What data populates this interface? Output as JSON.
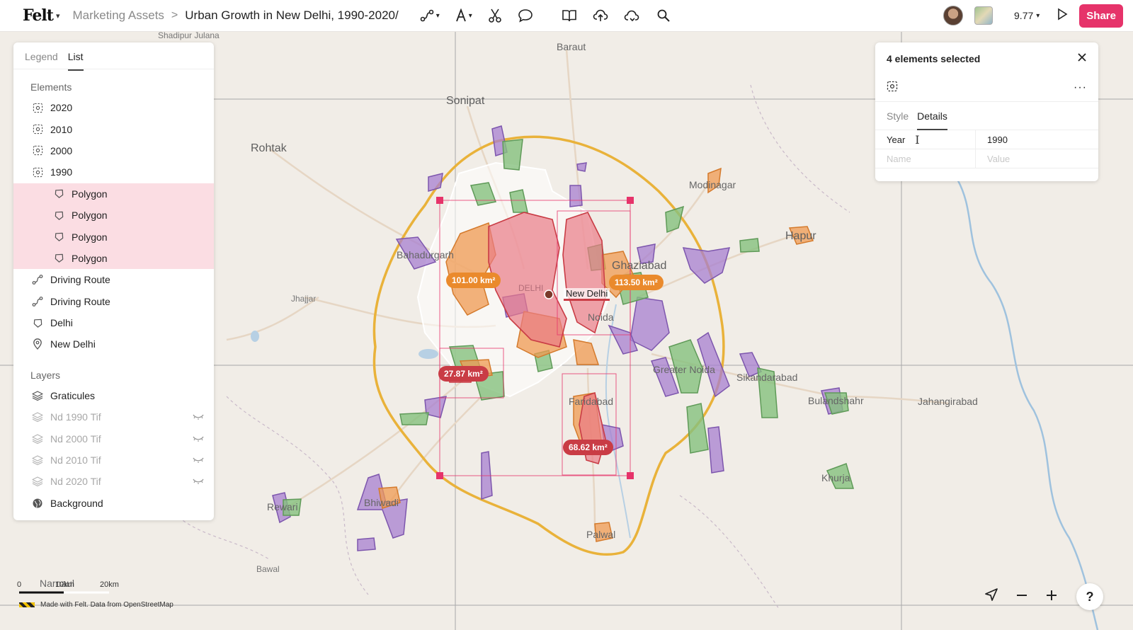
{
  "app": {
    "logo": "Felt"
  },
  "breadcrumb": {
    "parent": "Marketing Assets",
    "separator": ">",
    "title": "Urban Growth in New Delhi, 1990-2020/"
  },
  "toolbar": {
    "tools": [
      "route-tool-icon",
      "text-tool-icon",
      "scissors-icon",
      "comment-icon",
      "library-icon",
      "upload-icon",
      "cloud-data-icon",
      "search-icon"
    ],
    "zoom": "9.77",
    "share_label": "Share"
  },
  "left_panel": {
    "tabs": [
      "Legend",
      "List"
    ],
    "active_tab": "List",
    "elements_header": "Elements",
    "elements": [
      {
        "label": "2020",
        "icon": "group-icon",
        "indent": false,
        "highlighted": false
      },
      {
        "label": "2010",
        "icon": "group-icon",
        "indent": false,
        "highlighted": false
      },
      {
        "label": "2000",
        "icon": "group-icon",
        "indent": false,
        "highlighted": false
      },
      {
        "label": "1990",
        "icon": "group-icon",
        "indent": false,
        "highlighted": false
      },
      {
        "label": "Polygon",
        "icon": "polygon-icon",
        "indent": true,
        "highlighted": true
      },
      {
        "label": "Polygon",
        "icon": "polygon-icon",
        "indent": true,
        "highlighted": true
      },
      {
        "label": "Polygon",
        "icon": "polygon-icon",
        "indent": true,
        "highlighted": true
      },
      {
        "label": "Polygon",
        "icon": "polygon-icon",
        "indent": true,
        "highlighted": true
      },
      {
        "label": "Driving Route",
        "icon": "route-icon",
        "indent": false,
        "highlighted": false
      },
      {
        "label": "Driving Route",
        "icon": "route-icon",
        "indent": false,
        "highlighted": false
      },
      {
        "label": "Delhi",
        "icon": "polygon-icon",
        "indent": false,
        "highlighted": false
      },
      {
        "label": "New Delhi",
        "icon": "pin-icon",
        "indent": false,
        "highlighted": false
      }
    ],
    "layers_header": "Layers",
    "layers": [
      {
        "label": "Graticules",
        "icon": "layers-icon",
        "hidden": false
      },
      {
        "label": "Nd 1990 Tif",
        "icon": "layers-icon",
        "hidden": true
      },
      {
        "label": "Nd 2000 Tif",
        "icon": "layers-icon",
        "hidden": true
      },
      {
        "label": "Nd 2010 Tif",
        "icon": "layers-icon",
        "hidden": true
      },
      {
        "label": "Nd 2020 Tif",
        "icon": "layers-icon",
        "hidden": true
      },
      {
        "label": "Background",
        "icon": "globe-icon",
        "hidden": false
      }
    ]
  },
  "right_panel": {
    "title": "4 elements selected",
    "tabs": [
      "Style",
      "Details"
    ],
    "active_tab": "Details",
    "properties": [
      {
        "key": "Year",
        "value": "1990"
      }
    ],
    "new_key_placeholder": "Name",
    "new_value_placeholder": "Value"
  },
  "map": {
    "places": [
      "Shadipur Julana",
      "Baraut",
      "Sonipat",
      "Rohtak",
      "Modinagar",
      "Hapur",
      "Bahadurgarh",
      "Ghaziabad",
      "Jhajjar",
      "DELHI",
      "Noida",
      "Greater Noida",
      "Sikandarabad",
      "Bulandshahr",
      "Jahangirabad",
      "Faridabad",
      "Khurja",
      "Rewari",
      "Bhiwadi",
      "Palwal",
      "Bawal",
      "Narnaul"
    ],
    "area_labels": [
      {
        "text": "101.00 km²",
        "color": "#ea8a2c"
      },
      {
        "text": "113.50 km²",
        "color": "#ea8a2c"
      },
      {
        "text": "27.87 km²",
        "color": "#c93c45"
      },
      {
        "text": "68.62 km²",
        "color": "#c93c45"
      }
    ],
    "city_label": "New Delhi",
    "colors": {
      "ring": "#e9b23a",
      "orange": "#ef9a52",
      "purple": "#a77fd0",
      "green": "#86c17e",
      "red": "#e97a86",
      "selection": "#e6336a"
    }
  },
  "scale_bar": {
    "zero": "0",
    "mid": "10km",
    "max": "20km"
  },
  "attribution": "Made with Felt. Data from OpenStreetMap",
  "controls": {
    "help": "?"
  }
}
